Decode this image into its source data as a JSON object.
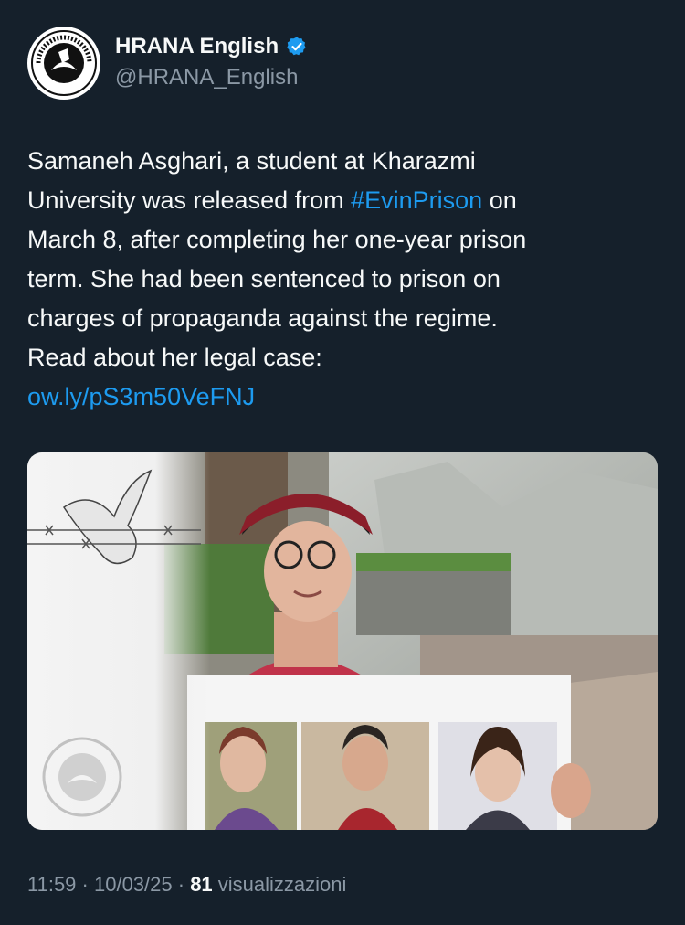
{
  "author": {
    "display_name": "HRANA English",
    "handle": "@HRANA_English",
    "verified": true,
    "avatar_icon": "hrana-logo-icon",
    "avatar_logo_text": "HUMAN RIGHTS ACTIVISTS IN IRAN"
  },
  "tweet": {
    "line1": "Samaneh Asghari, a student at Kharazmi",
    "line2_pre": "University was released from ",
    "hashtag": "#EvinPrison",
    "line2_post": " on",
    "line3": "March 8, after completing her one-year prison",
    "line4": "term. She had been sentenced to prison on",
    "line5": "charges of propaganda against the regime.",
    "line6": "Read about her legal case:",
    "link": "ow.ly/pS3m50VeFNJ"
  },
  "media": {
    "icon": "photo-of-woman-holding-sign",
    "watermark_icon": "hrana-watermark-icon",
    "dove_icon": "dove-barbed-wire-icon"
  },
  "meta": {
    "time": "11:59",
    "separator": " · ",
    "date": "10/03/25",
    "views_count": "81",
    "views_label": " visualizzazioni"
  },
  "colors": {
    "background": "#15202b",
    "text": "#f7f9f9",
    "secondary": "#8b98a5",
    "link": "#1d9bf0"
  }
}
